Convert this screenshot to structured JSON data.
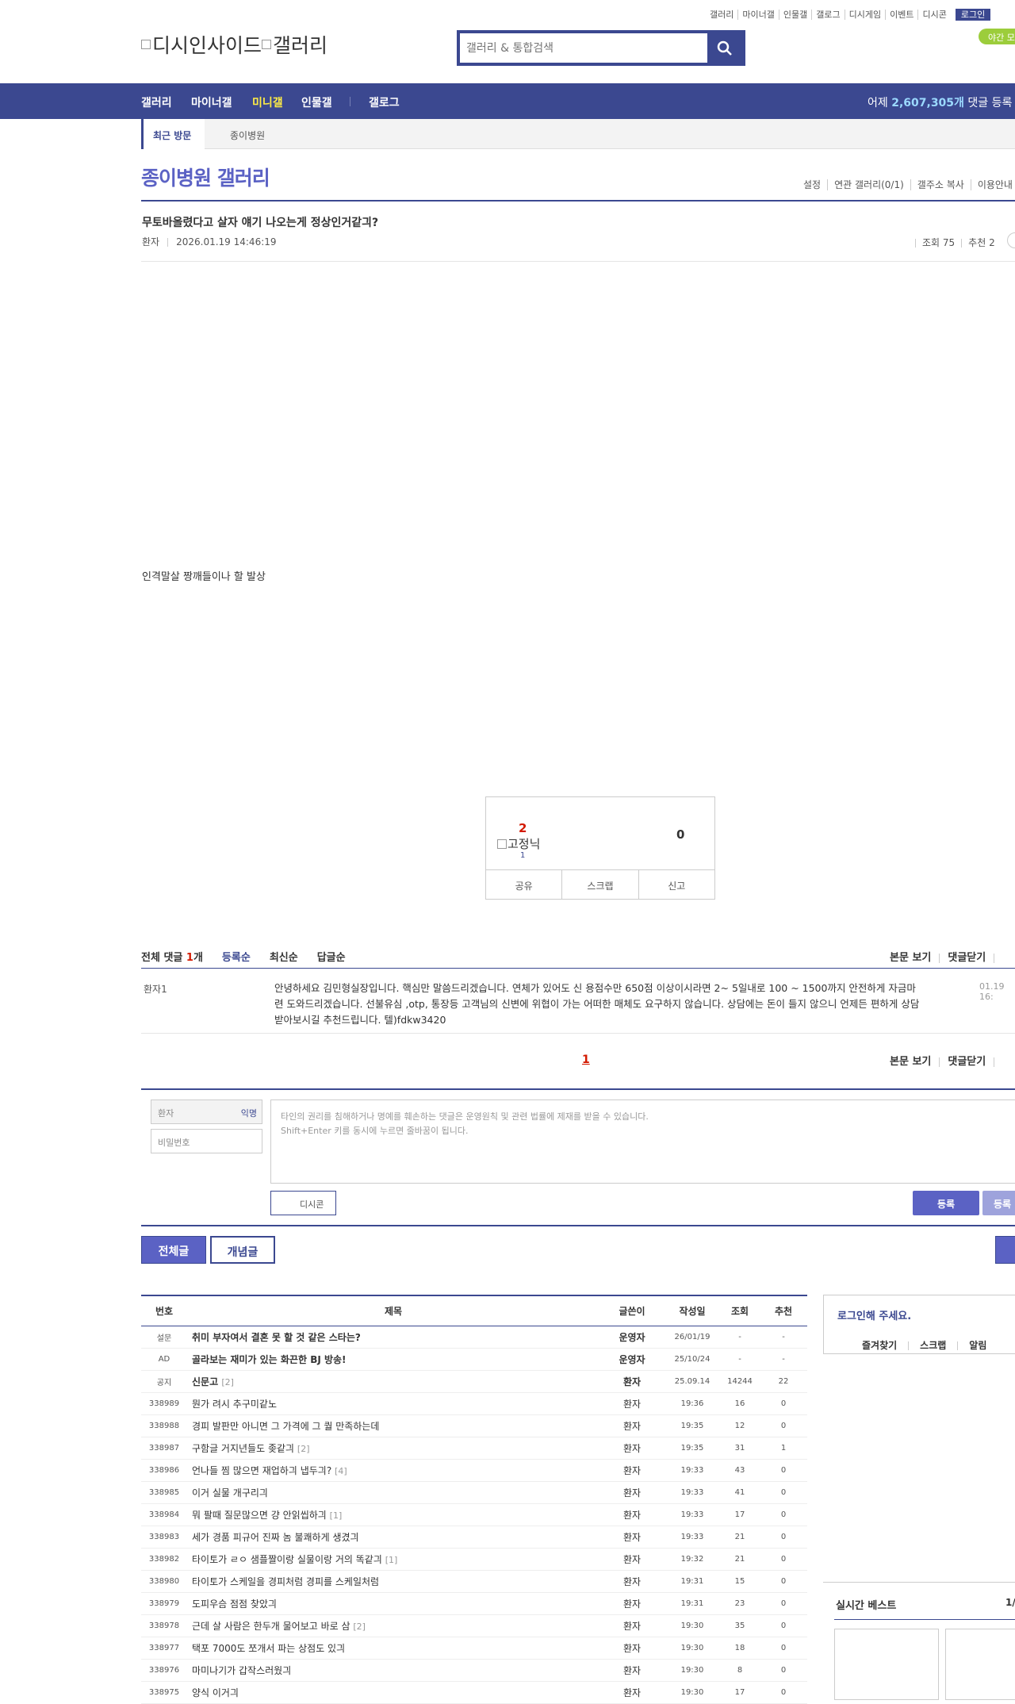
{
  "util": {
    "links": [
      "갤러리",
      "마이너갤",
      "인물갤",
      "갤로그",
      "디시게임",
      "이벤트",
      "디시콘"
    ],
    "login": "로그인",
    "night": "야간 모드"
  },
  "logo": {
    "text": "디시인사이드",
    "text2": "갤러리"
  },
  "search": {
    "placeholder": "갤러리 & 통합검색"
  },
  "gnb": {
    "items": [
      "갤러리",
      "마이너갤",
      "미니갤",
      "인물갤",
      "갤로그"
    ],
    "count_prefix": "어제 ",
    "count_value": "2,607,305개",
    "count_suffix": " 댓글 등록"
  },
  "visit": {
    "label": "최근 방문",
    "gallery": "종이병원"
  },
  "gallery": {
    "title": "종이병원 갤러리",
    "menu": [
      "설정",
      "연관 갤러리(0/1)",
      "갤주소 복사",
      "이용안내"
    ]
  },
  "post": {
    "title": "무토바올렸다고 살자 얘기 나오는게 정상인거같긔?",
    "author": "환자",
    "date": "2026.01.19 14:46:19",
    "views": "조회 75",
    "recommend": "추천 2",
    "body": "인격말살 짱깨들이나 할 발상"
  },
  "vote": {
    "up": "2",
    "fix_label": "고정닉",
    "fix_count": "1",
    "down": "0",
    "share": "공유",
    "scrap": "스크랩",
    "report": "신고"
  },
  "comments": {
    "label_prefix": "전체 댓글 ",
    "count": "1",
    "label_suffix": "개",
    "sorts": [
      "등록순",
      "최신순",
      "답글순"
    ],
    "view_body": "본문 보기",
    "close": "댓글닫기",
    "items": [
      {
        "name": "환자1",
        "text": "안녕하세요 김민형실장입니다. 핵심만 말씀드리겠습니다. 연체가 있어도 신 용점수만 650점 이상이시라면 2~ 5일내로 100 ~ 1500까지 안전하게 자금마련 도와드리겠습니다. 선불유심 ,otp, 통장등 고객님의 신변에 위협이 가는 어떠한 매체도 요구하지 않습니다. 상담에는 돈이 들지 않으니 언제든 편하게 상담 받아보시길 추천드립니다. 텔)fdkw3420",
        "date": "01.19 16:"
      }
    ],
    "page": "1"
  },
  "write": {
    "name": "환자",
    "anon": "익명",
    "password": "비밀번호",
    "placeholder_line1": "타인의 권리를 침해하거나 명예를 훼손하는 댓글은 운영원칙 및 관련 법률에 제재를 받을 수 있습니다.",
    "placeholder_line2": "Shift+Enter 키를 동시에 누르면 줄바꿈이 됩니다.",
    "dccon": "디시콘",
    "submit": "등록",
    "submit2": "등록"
  },
  "tabs": {
    "all": "전체글",
    "best": "개념글"
  },
  "list": {
    "headers": [
      "번호",
      "제목",
      "글쓴이",
      "작성일",
      "조회",
      "추천"
    ],
    "rows": [
      {
        "num": "설문",
        "subject": "취미 부자여서 결혼 못 할 것 같은 스타는?",
        "reply": "",
        "writer": "운영자",
        "date": "26/01/19",
        "views": "-",
        "rec": "-",
        "notice": true
      },
      {
        "num": "AD",
        "subject": "골라보는 재미가 있는 화끈한 BJ 방송!",
        "reply": "",
        "writer": "운영자",
        "date": "25/10/24",
        "views": "-",
        "rec": "-",
        "notice": true
      },
      {
        "num": "공지",
        "subject": "신문고",
        "reply": "[2]",
        "writer": "환자",
        "date": "25.09.14",
        "views": "14244",
        "rec": "22",
        "notice": true
      },
      {
        "num": "338989",
        "subject": "뭔가 려시 추구미같노",
        "reply": "",
        "writer": "환자",
        "date": "19:36",
        "views": "16",
        "rec": "0",
        "notice": false
      },
      {
        "num": "338988",
        "subject": "경피 발판만 아니면 그 가격에 그 퀄 만족하는데",
        "reply": "",
        "writer": "환자",
        "date": "19:35",
        "views": "12",
        "rec": "0",
        "notice": false
      },
      {
        "num": "338987",
        "subject": "구함글 거지년들도 좆같긔",
        "reply": "[2]",
        "writer": "환자",
        "date": "19:35",
        "views": "31",
        "rec": "1",
        "notice": false
      },
      {
        "num": "338986",
        "subject": "언나들 찜 많으면 재업하긔 냅두긔?",
        "reply": "[4]",
        "writer": "환자",
        "date": "19:33",
        "views": "43",
        "rec": "0",
        "notice": false
      },
      {
        "num": "338985",
        "subject": "이거 실물 개구리긔",
        "reply": "",
        "writer": "환자",
        "date": "19:33",
        "views": "41",
        "rec": "0",
        "notice": false
      },
      {
        "num": "338984",
        "subject": "뭐 팔때 질문많으면 걍 안읽씹하긔",
        "reply": "[1]",
        "writer": "환자",
        "date": "19:33",
        "views": "17",
        "rec": "0",
        "notice": false
      },
      {
        "num": "338983",
        "subject": "세가 경품 피규어 진짜 놈 불쾌하게 생겼긔",
        "reply": "",
        "writer": "환자",
        "date": "19:33",
        "views": "21",
        "rec": "0",
        "notice": false
      },
      {
        "num": "338982",
        "subject": "타이토가 ㄹㅇ 샘플짤이랑 실물이랑 거의 똑같긔",
        "reply": "[1]",
        "writer": "환자",
        "date": "19:32",
        "views": "21",
        "rec": "0",
        "notice": false
      },
      {
        "num": "338980",
        "subject": "타이토가 스케일을 경피처럼 경피를 스케일처럼",
        "reply": "",
        "writer": "환자",
        "date": "19:31",
        "views": "15",
        "rec": "0",
        "notice": false
      },
      {
        "num": "338979",
        "subject": "도피우슴 점점 찾았긔",
        "reply": "",
        "writer": "환자",
        "date": "19:31",
        "views": "23",
        "rec": "0",
        "notice": false
      },
      {
        "num": "338978",
        "subject": "근데 살 사람은 한두개 물어보고 바로 삼",
        "reply": "[2]",
        "writer": "환자",
        "date": "19:30",
        "views": "35",
        "rec": "0",
        "notice": false
      },
      {
        "num": "338977",
        "subject": "택포 7000도 쪼개서 파는 상점도 있긔",
        "reply": "",
        "writer": "환자",
        "date": "19:30",
        "views": "18",
        "rec": "0",
        "notice": false
      },
      {
        "num": "338976",
        "subject": "마미나기가 갑작스러웠긔",
        "reply": "",
        "writer": "환자",
        "date": "19:30",
        "views": "8",
        "rec": "0",
        "notice": false
      },
      {
        "num": "338975",
        "subject": "양식 이거긔",
        "reply": "",
        "writer": "환자",
        "date": "19:30",
        "views": "17",
        "rec": "0",
        "notice": false
      }
    ]
  },
  "right": {
    "login_title": "로그인해 주세요.",
    "menu": [
      "즐겨찾기",
      "스크랩",
      "알림"
    ],
    "best_title": "실시간 베스트",
    "best_page": "1/"
  },
  "colors": {
    "brand": "#3b4890",
    "accent": "#5b62c4",
    "highlight": "#ffed45",
    "red": "#d31900"
  }
}
